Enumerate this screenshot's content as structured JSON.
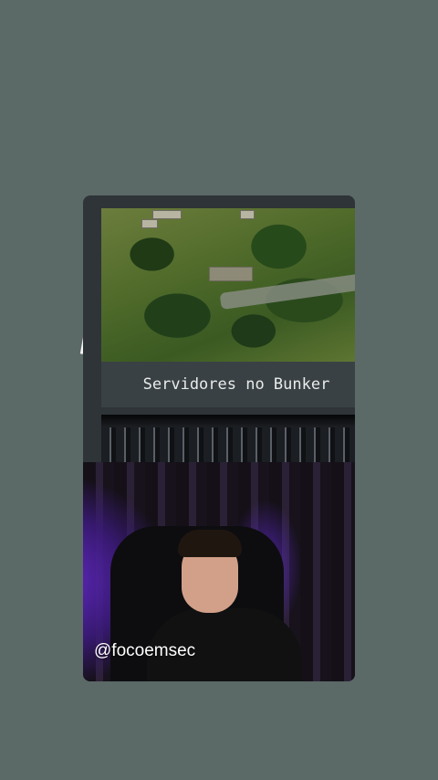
{
  "slide": {
    "caption": "Servidores no Bunker"
  },
  "video": {
    "handle": "@focoemsec"
  },
  "icons": {
    "pointer": "cursor-arrow-icon",
    "annotation": "pen-stroke-icon"
  },
  "colors": {
    "background": "#5b6967",
    "card": "#2e3437",
    "caption_bg": "#3a4144",
    "glow": "#6b2bd8"
  }
}
